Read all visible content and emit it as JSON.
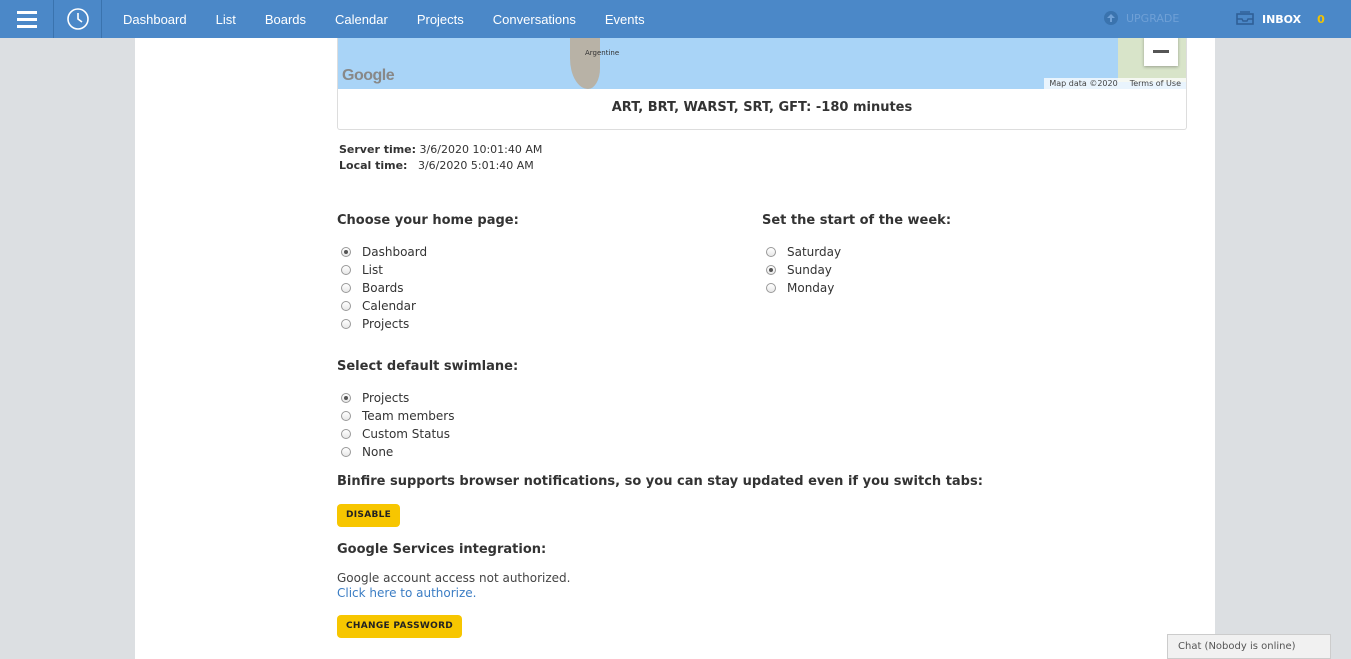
{
  "nav": {
    "items": [
      "Dashboard",
      "List",
      "Boards",
      "Calendar",
      "Projects",
      "Conversations",
      "Events"
    ],
    "upgrade": "UPGRADE",
    "inbox_label": "INBOX",
    "inbox_count": "0"
  },
  "map": {
    "logo": "Google",
    "label_country": "Argentine",
    "attribution": "Map data ©2020",
    "terms": "Terms of Use",
    "timezone": "ART, BRT, WARST, SRT, GFT: -180 minutes"
  },
  "times": {
    "server_label": "Server time:",
    "server_value": "3/6/2020 10:01:40 AM",
    "local_label": "Local time:",
    "local_value": "3/6/2020 5:01:40 AM"
  },
  "home": {
    "title": "Choose your home page:",
    "options": [
      "Dashboard",
      "List",
      "Boards",
      "Calendar",
      "Projects"
    ],
    "selected": "Dashboard"
  },
  "week": {
    "title": "Set the start of the week:",
    "options": [
      "Saturday",
      "Sunday",
      "Monday"
    ],
    "selected": "Sunday"
  },
  "swimlane": {
    "title": "Select default swimlane:",
    "options": [
      "Projects",
      "Team members",
      "Custom Status",
      "None"
    ],
    "selected": "Projects"
  },
  "notifications": {
    "title": "Binfire supports browser notifications, so you can stay updated even if you switch tabs:",
    "button": "DISABLE"
  },
  "google": {
    "title": "Google Services integration:",
    "status": "Google account access not authorized.",
    "link": "Click here to authorize."
  },
  "password": {
    "button": "CHANGE PASSWORD"
  },
  "chat": {
    "label": "Chat (Nobody is online)"
  },
  "colors": {
    "topbar": "#4b88c8",
    "button": "#f7c600",
    "link": "#3b7dc4",
    "inbox_count": "#f3c300"
  }
}
